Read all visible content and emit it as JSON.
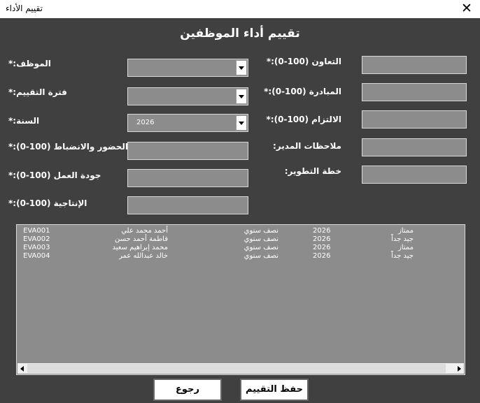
{
  "window": {
    "title": "تقييم الأداء",
    "close_glyph": "✕"
  },
  "form": {
    "title": "تقييم أداء الموظفين",
    "labels": {
      "cooperation": "التعاون (100-0):*",
      "initiative": "المبادرة (100-0):*",
      "commitment": "الالتزام (100-0):*",
      "manager_notes": "ملاحظات المدير:",
      "development_plan": "خطة التطوير:",
      "employee": "الموظف:*",
      "eval_period": "فترة التقييم:*",
      "year": "السنة:*",
      "attendance": "الحضور والانضباط (100-0):*",
      "work_quality": "جودة العمل (100-0):*",
      "productivity": "الإنتاجية (100-0):*"
    },
    "year_value": "2026"
  },
  "list": {
    "rows": [
      {
        "id": "EVA001",
        "name": "أحمد محمد علي",
        "period": "نصف سنوي",
        "year": "2026",
        "rating": "ممتاز"
      },
      {
        "id": "EVA002",
        "name": "فاطمة أحمد حسن",
        "period": "نصف سنوي",
        "year": "2026",
        "rating": "جيد جداً"
      },
      {
        "id": "EVA003",
        "name": "محمد إبراهيم سعيد",
        "period": "نصف سنوي",
        "year": "2026",
        "rating": "ممتاز"
      },
      {
        "id": "EVA004",
        "name": "خالد عبدالله عمر",
        "period": "نصف سنوي",
        "year": "2026",
        "rating": "جيد جداً"
      }
    ]
  },
  "buttons": {
    "save": "حفظ التقييم",
    "back": "رجوع"
  }
}
